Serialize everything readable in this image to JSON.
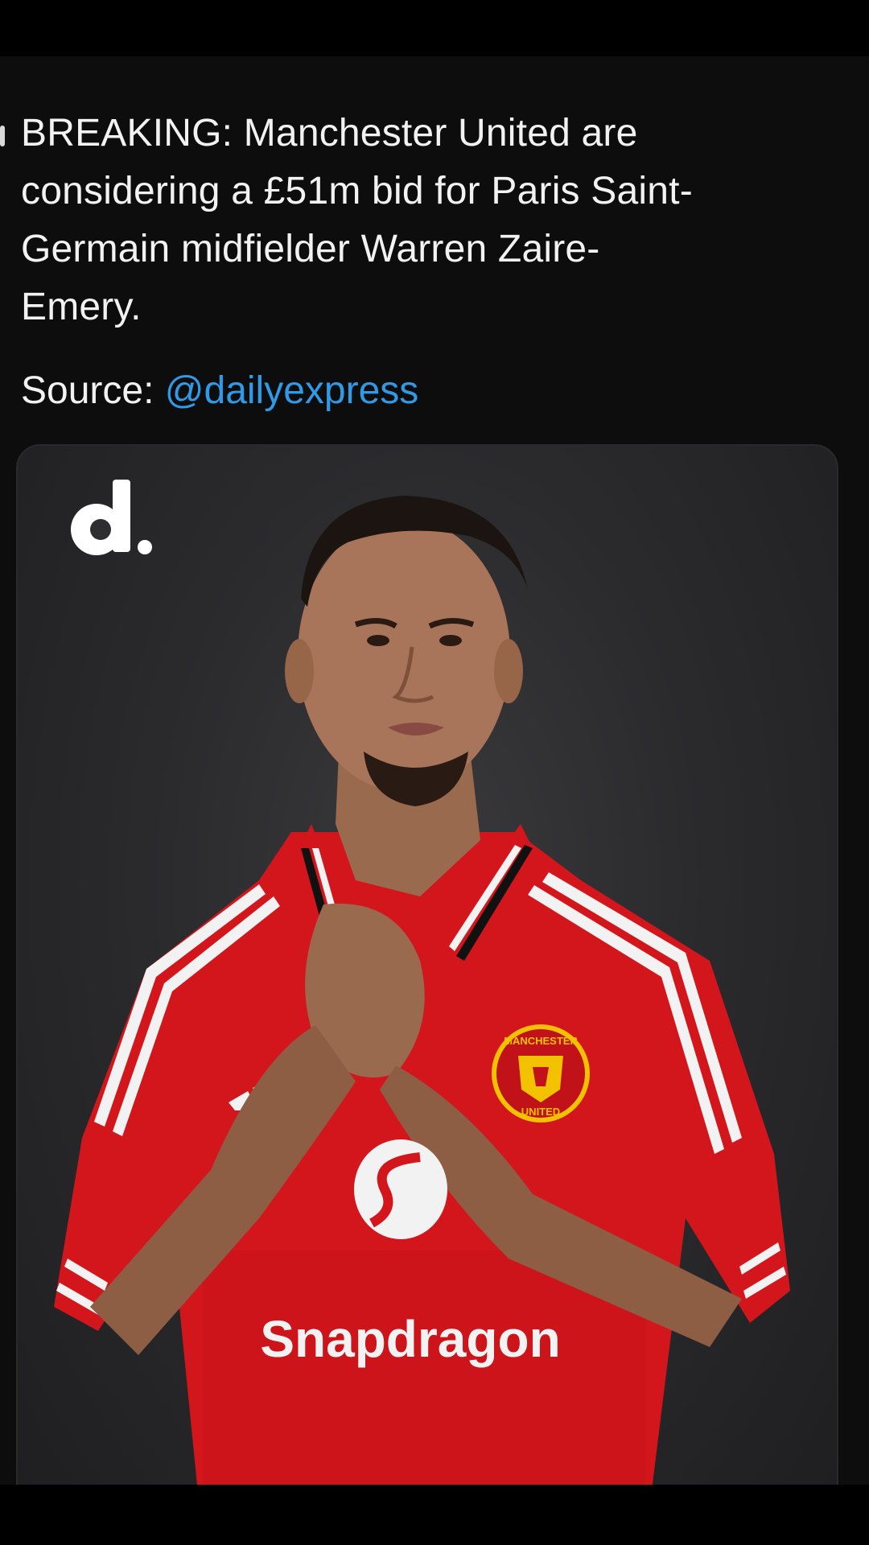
{
  "post": {
    "prefix_mark": "",
    "headline": "BREAKING: Manchester United are considering a £51m bid for Paris Saint-Germain midfielder Warren Zaire-Emery.",
    "headline_lines": [
      "BREAKING: Manchester United are",
      "considering a £51m bid for Paris Saint-",
      "Germain midfielder Warren Zaire-",
      "Emery."
    ],
    "source_label": "Source: ",
    "source_handle": "@dailyexpress"
  },
  "media": {
    "publisher_logo_icon": "daily-express-d-logo",
    "photo_subject": "footballer-in-red-kit-photo",
    "shirt_sponsor": "Snapdragon",
    "crest_top_text": "MANCHESTER",
    "crest_bottom_text": "UNITED"
  },
  "colors": {
    "background": "#0d0d0e",
    "text": "#f2f2f2",
    "link": "#2f9ae6",
    "shirt_red": "#d9171d"
  }
}
